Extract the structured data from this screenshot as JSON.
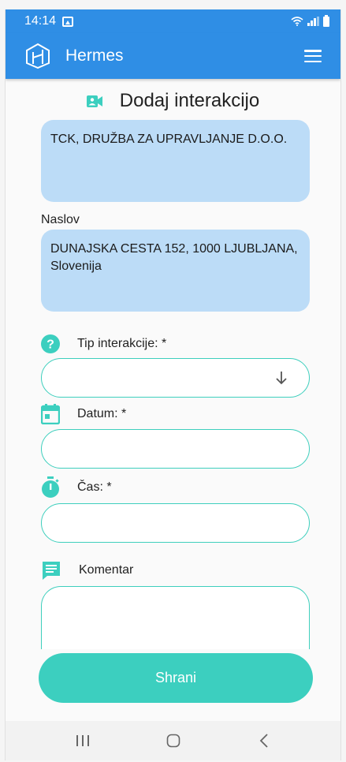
{
  "status_bar": {
    "time": "14:14"
  },
  "app_bar": {
    "title": "Hermes"
  },
  "page": {
    "heading": "Dodaj interakcijo"
  },
  "company": {
    "name": "TCK, DRUŽBA ZA UPRAVLJANJE D.O.O."
  },
  "address": {
    "label": "Naslov",
    "value": "DUNAJSKA CESTA 152, 1000 LJUBLJANA, Slovenija"
  },
  "form": {
    "type_label": "Tip interakcije: *",
    "type_value": "",
    "date_label": "Datum: *",
    "date_value": "",
    "time_label": "Čas: *",
    "time_value": "",
    "comment_label": "Komentar",
    "comment_value": ""
  },
  "actions": {
    "save_label": "Shrani"
  },
  "colors": {
    "primary": "#2f8ee5",
    "accent": "#3ccfbf",
    "box": "#bcdcf7"
  }
}
